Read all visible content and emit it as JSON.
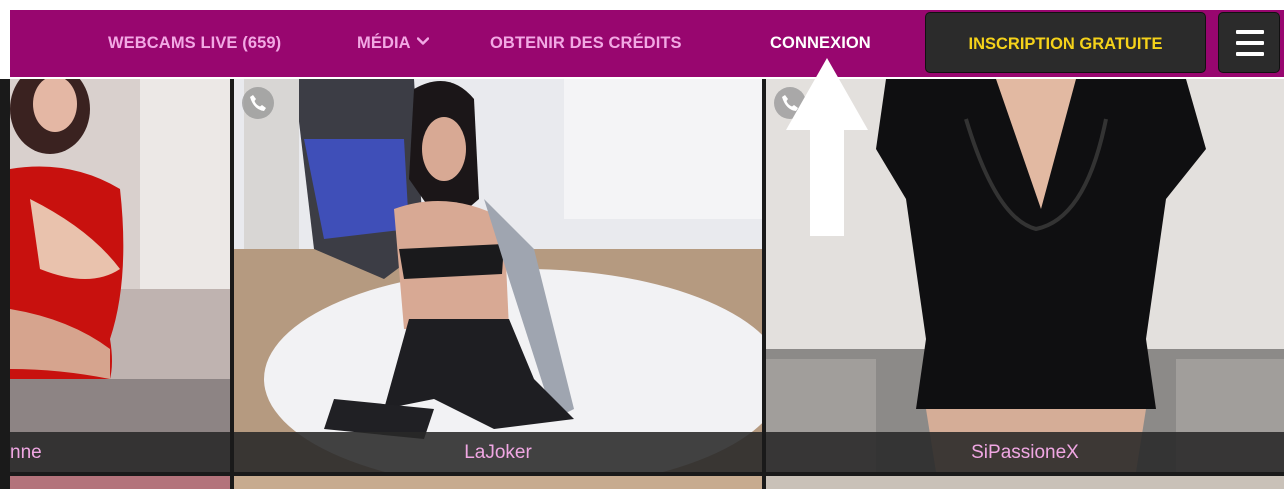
{
  "nav": {
    "webcams_live": "WEBCAMS LIVE (659)",
    "media": "MÉDIA",
    "get_credits": "OBTENIR DES CRÉDITS",
    "login": "CONNEXION",
    "signup": "INSCRIPTION GRATUITE"
  },
  "icons": {
    "media_dropdown": "chevron-down-icon",
    "menu": "hamburger-menu-icon",
    "phone": "phone-icon",
    "annotation": "up-arrow-annotation"
  },
  "colors": {
    "nav_bg": "#98066f",
    "nav_text": "#f2a8e4",
    "signup_text": "#f5d21a",
    "caption_text": "#f0a7e3"
  },
  "performers": [
    {
      "name": "nne"
    },
    {
      "name": "LaJoker"
    },
    {
      "name": "SiPassioneX"
    }
  ]
}
